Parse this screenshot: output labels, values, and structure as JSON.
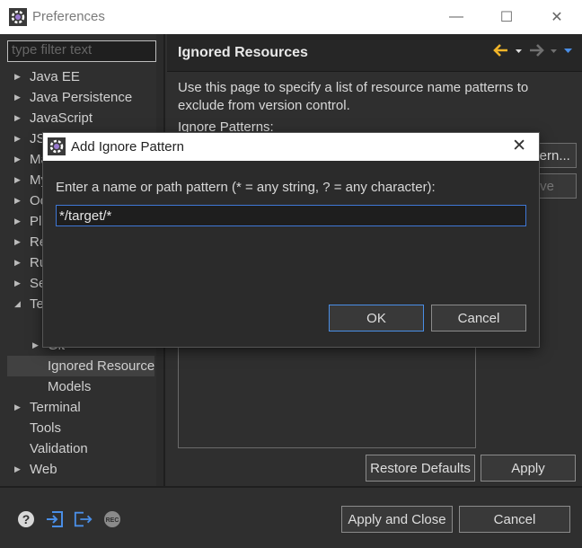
{
  "window": {
    "title": "Preferences",
    "minimize": "—",
    "maximize": "☐",
    "close": "✕"
  },
  "sidebar": {
    "filter_placeholder": "type filter text",
    "items": [
      {
        "label": "Java EE",
        "arrow": "▶"
      },
      {
        "label": "Java Persistence",
        "arrow": "▶"
      },
      {
        "label": "JavaScript",
        "arrow": "▶"
      },
      {
        "label": "JS",
        "arrow": "▶"
      },
      {
        "label": "Ma",
        "arrow": "▶"
      },
      {
        "label": "My",
        "arrow": "▶"
      },
      {
        "label": "Oo",
        "arrow": "▶"
      },
      {
        "label": "Plu",
        "arrow": "▶"
      },
      {
        "label": "Re",
        "arrow": "▶"
      },
      {
        "label": "Ru",
        "arrow": "▶"
      },
      {
        "label": "Se",
        "arrow": "▶"
      },
      {
        "label": "Te",
        "arrow": "◢"
      },
      {
        "label": "",
        "arrow": ""
      },
      {
        "label": "Git",
        "arrow": "▶"
      },
      {
        "label": "Ignored Resources",
        "arrow": ""
      },
      {
        "label": "Models",
        "arrow": ""
      },
      {
        "label": "Terminal",
        "arrow": "▶"
      },
      {
        "label": "Tools",
        "arrow": ""
      },
      {
        "label": "Validation",
        "arrow": ""
      },
      {
        "label": "Web",
        "arrow": "▶"
      }
    ]
  },
  "main": {
    "title": "Ignored Resources",
    "description": "Use this page to specify a list of resource name patterns to exclude from version control.",
    "ignore_label": "Ignore Patterns:",
    "add_pattern_button": "Add Pattern...",
    "remove_button": "Remove",
    "restore_defaults_button": "Restore Defaults",
    "apply_button": "Apply"
  },
  "bottom": {
    "apply_close_button": "Apply and Close",
    "cancel_button": "Cancel",
    "rec_label": "REC"
  },
  "dialog": {
    "title": "Add Ignore Pattern",
    "close": "✕",
    "prompt": "Enter a name or path pattern (* = any string, ? = any character):",
    "input_value": "*/target/*",
    "ok_button": "OK",
    "cancel_button": "Cancel"
  },
  "colors": {
    "accent_yellow": "#f0b429",
    "accent_blue": "#3f77d6",
    "dark_bg": "#2f2f2f"
  },
  "icons": [
    "preferences-gear-icon",
    "back-arrow-icon",
    "forward-arrow-icon",
    "help-icon",
    "import-icon",
    "export-icon",
    "record-icon"
  ]
}
